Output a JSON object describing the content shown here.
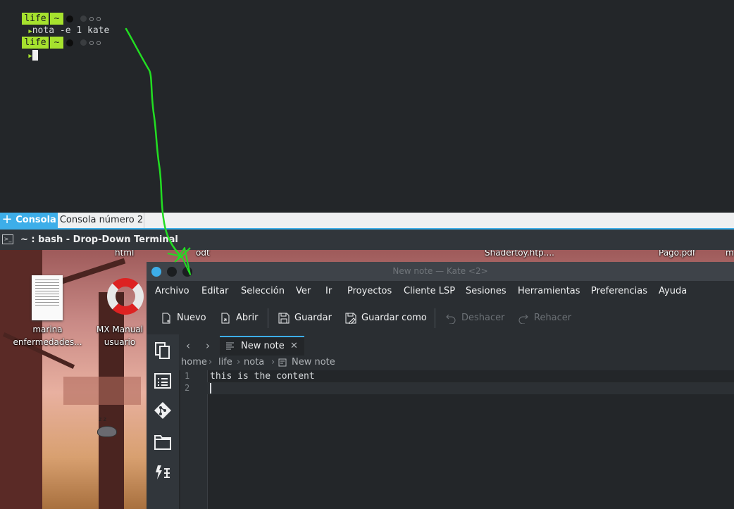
{
  "terminal": {
    "line1": {
      "seg_life": "life",
      "seg_tilde": "~"
    },
    "command": "nota -e 1 kate",
    "line3": {
      "seg_life": "life",
      "seg_tilde": "~"
    },
    "prompt_arrow": "▶"
  },
  "console_tabs": {
    "add_icon": "+",
    "tabs": [
      {
        "label": "Consola",
        "active": true
      },
      {
        "label": "Consola número 2",
        "active": false
      }
    ]
  },
  "window_title": {
    "icon": ">_",
    "text": "~ : bash - Drop-Down Terminal"
  },
  "desktop": {
    "top_labels": [
      "html",
      "odt",
      "Shadertoy.htp....",
      "Pago.pdf",
      "m"
    ],
    "icons": [
      {
        "label_line1": "marina",
        "label_line2": "enfermedades..."
      },
      {
        "label_line1": "MX Manual",
        "label_line2": "usuario"
      }
    ],
    "sleep_text": "z z"
  },
  "kate": {
    "title": "New note — Kate <2>",
    "menu": [
      "Archivo",
      "Editar",
      "Selección",
      "Ver",
      "Ir",
      "Proyectos",
      "Cliente LSP",
      "Sesiones",
      "Herramientas",
      "Preferencias",
      "Ayuda"
    ],
    "toolbar": {
      "new_label": "Nuevo",
      "open_label": "Abrir",
      "save_label": "Guardar",
      "save_as_label": "Guardar como",
      "undo_label": "Deshacer",
      "redo_label": "Rehacer"
    },
    "tab": {
      "label": "New note",
      "close": "✕"
    },
    "nav": {
      "back": "‹",
      "forward": "›"
    },
    "breadcrumb": [
      "home",
      "life",
      "nota",
      "New note"
    ],
    "breadcrumb_sep": "›",
    "editor": {
      "line_numbers": [
        "1",
        "2"
      ],
      "lines": [
        "this is the content",
        ""
      ]
    }
  },
  "colors": {
    "accent": "#3daee9",
    "prompt_green": "#a6e22e",
    "annotation_green": "#22dd22"
  }
}
